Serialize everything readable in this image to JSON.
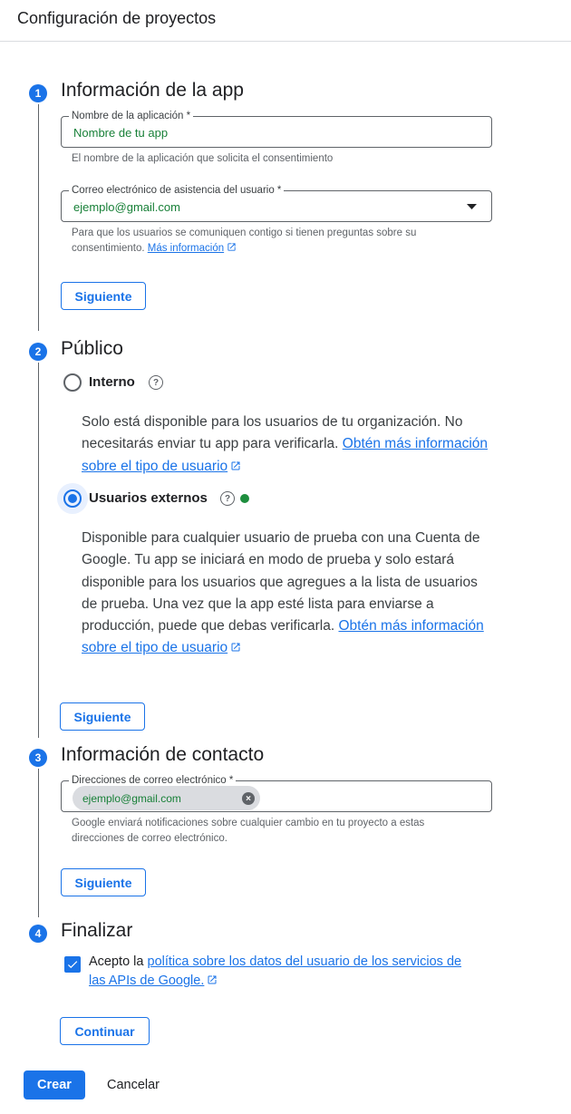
{
  "header": {
    "title": "Configuración de proyectos"
  },
  "steps": {
    "app_info": {
      "number": "1",
      "title": "Información de la app",
      "app_name": {
        "label": "Nombre de la aplicación *",
        "value": "Nombre de tu app",
        "help": "El nombre de la aplicación que solicita el consentimiento"
      },
      "support_email": {
        "label": "Correo electrónico de asistencia del usuario *",
        "value": "ejemplo@gmail.com",
        "help": "Para que los usuarios se comuniquen contigo si tienen preguntas sobre su consentimiento.",
        "link": "Más información"
      },
      "next_label": "Siguiente"
    },
    "audience": {
      "number": "2",
      "title": "Público",
      "internal": {
        "label": "Interno",
        "selected": false,
        "description": "Solo está disponible para los usuarios de tu organización. No necesitarás enviar tu app para verificarla.",
        "link": "Obtén más información sobre el tipo de usuario"
      },
      "external": {
        "label": "Usuarios externos",
        "selected": true,
        "description": "Disponible para cualquier usuario de prueba con una Cuenta de Google. Tu app se iniciará en modo de prueba y solo estará disponible para los usuarios que agregues a la lista de usuarios de prueba. Una vez que la app esté lista para enviarse a producción, puede que debas verificarla.",
        "link": "Obtén más información sobre el tipo de usuario"
      },
      "next_label": "Siguiente"
    },
    "contact": {
      "number": "3",
      "title": "Información de contacto",
      "emails": {
        "label": "Direcciones de correo electrónico *",
        "chips": [
          "ejemplo@gmail.com"
        ],
        "help": "Google enviará notificaciones sobre cualquier cambio en tu proyecto a estas direcciones de correo electrónico."
      },
      "next_label": "Siguiente"
    },
    "finish": {
      "number": "4",
      "title": "Finalizar",
      "consent_prefix": "Acepto la",
      "consent_link": "política sobre los datos del usuario de los servicios de las APIs de Google.",
      "checked": true,
      "continue_label": "Continuar"
    }
  },
  "footer": {
    "create_label": "Crear",
    "cancel_label": "Cancelar"
  },
  "colors": {
    "accent": "#1a73e8",
    "value_green": "#188038",
    "status_dot": "#1e8e3e"
  },
  "icons": [
    "expand-icon",
    "help-icon",
    "external-link-icon",
    "clear-chip-icon",
    "check-icon",
    "status-dot-icon"
  ]
}
